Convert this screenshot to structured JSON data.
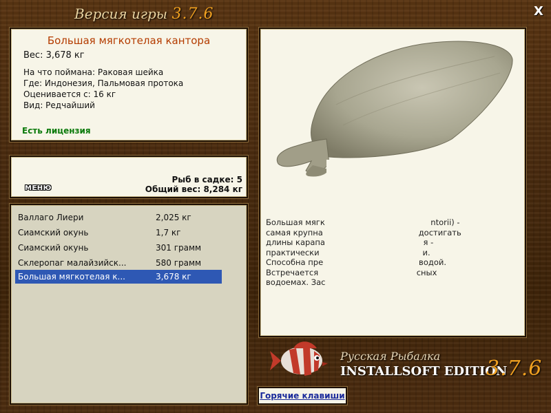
{
  "header": {
    "title_text": "Версия игры ",
    "title_version": "3.7.6",
    "close_label": "X"
  },
  "fish_info": {
    "name": "Большая мягкотелая кантора",
    "weight": "Вес: 3,678 кг",
    "rows": [
      "На что поймана: Раковая шейка",
      "Где: Индонезия, Пальмовая протока",
      "Оценивается с: 16 кг",
      "Вид: Редчайший"
    ],
    "license": "Есть лицензия"
  },
  "keepnet": {
    "menu_label": "МЕНЮ",
    "count": "Рыб в садке: 5",
    "total": "Общий вес: 8,284 кг"
  },
  "catch_list": [
    {
      "name": "Валлаго Лиери",
      "weight": "2,025 кг",
      "selected": false
    },
    {
      "name": "Сиамский окунь",
      "weight": "1,7 кг",
      "selected": false
    },
    {
      "name": "Сиамский окунь",
      "weight": "301 грамм",
      "selected": false
    },
    {
      "name": "Склеропаг малайзийск...",
      "weight": "580 грамм",
      "selected": false
    },
    {
      "name": "Большая мягкотелая к...",
      "weight": "3,678 кг",
      "selected": true
    }
  ],
  "description": {
    "lines": [
      "Большая мягк                                          ntorii) -",
      "самая крупна                                      достигать",
      "длины карапа                                       я -",
      "практически                                         и.",
      "Способна пре                                      водой.",
      "Встречается                                       сных",
      "водоемах. Зас"
    ]
  },
  "logo": {
    "line1": "Русская Рыбалка",
    "line2": "INSTALLSOFT EDITION",
    "version": "3.7.6"
  },
  "hotkeys_label": "Горячие клавиши",
  "colors": {
    "accent_orange": "#f0a020",
    "fish_name": "#b43c00",
    "license_green": "#0b7a0b",
    "selection_blue": "#2e58b4"
  }
}
